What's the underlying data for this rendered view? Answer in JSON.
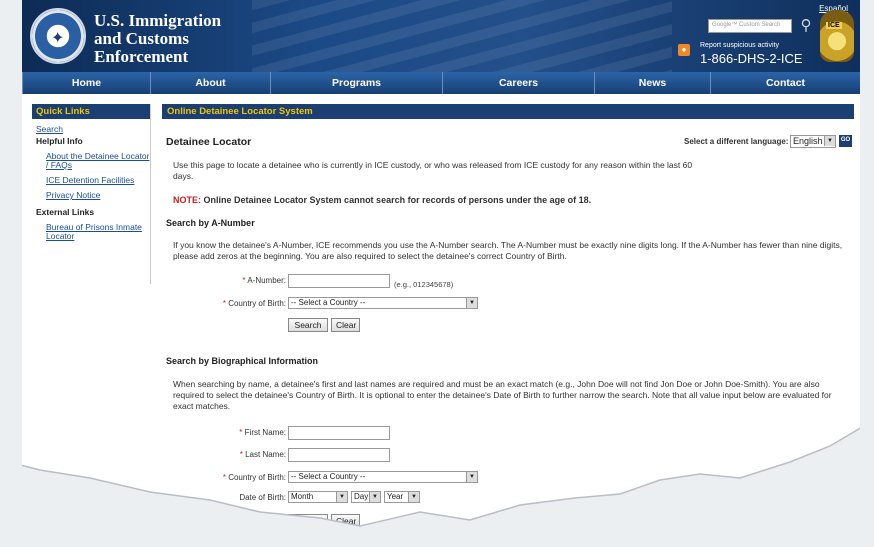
{
  "header": {
    "title_lines": [
      "U.S. Immigration",
      "and Customs",
      "Enforcement"
    ],
    "espanol": "Español",
    "search_placeholder": "Google™ Custom Search",
    "report_label": "Report suspicious activity",
    "report_phone": "1-866-DHS-2-ICE",
    "badge_text": "ICE"
  },
  "nav": [
    {
      "label": "Home"
    },
    {
      "label": "About"
    },
    {
      "label": "Programs"
    },
    {
      "label": "Careers"
    },
    {
      "label": "News"
    },
    {
      "label": "Contact"
    }
  ],
  "sidebar": {
    "title": "Quick Links",
    "search": "Search",
    "helpful_info": "Helpful Info",
    "about_link": "About the Detainee Locator / FAQs",
    "detention_link": "ICE Detention Facilities",
    "privacy_link": "Privacy Notice",
    "external_links": "External Links",
    "bop_link": "Bureau of Prisons Inmate Locator"
  },
  "content": {
    "bar_title": "Online Detainee Locator System",
    "page_title": "Detainee Locator",
    "language_label": "Select a different language:",
    "language_value": "English",
    "go_label": "GO",
    "intro": "Use this page to locate a detainee who is currently in ICE custody, or who was released from ICE custody for any reason within the last 60 days.",
    "note_label": "NOTE:",
    "note_text": "Online Detainee Locator System cannot search for records of persons under the age of 18.",
    "anumber_heading": "Search by A-Number",
    "anumber_text": "If you know the detainee's A-Number, ICE recommends you use the A-Number search. The A-Number must be exactly nine digits long. If the A-Number has fewer than nine digits, please add zeros at the beginning. You are also required to select the detainee's correct Country of Birth.",
    "anumber_label": "A-Number:",
    "anumber_example": "(e.g., 012345678)",
    "country_label": "Country of Birth:",
    "country_value": "-- Select a Country --",
    "search_button": "Search",
    "clear_button": "Clear",
    "bio_heading": "Search by Biographical Information",
    "bio_text": "When searching by name, a detainee's first and last names are required and must be an exact match (e.g., John Doe will not find Jon Doe or John Doe-Smith). You are also required to select the detainee's Country of Birth. It is optional to enter the detainee's Date of Birth to further narrow the search. Note that all value input below are evaluated for exact matches.",
    "first_name_label": "First Name:",
    "last_name_label": "Last Name:",
    "country_label2": "Country of Birth:",
    "country_value2": "-- Select a Country --",
    "dob_label": "Date of Birth:",
    "month_value": "Month",
    "day_value": "Day",
    "year_value": "Year",
    "search_button2": "Search",
    "clear_button2": "Clear",
    "required_mark": "*"
  },
  "colors": {
    "header_navy": "#1b3f73",
    "quick_link_yellow": "#f0c400",
    "note_red": "#c62020",
    "link_blue": "#1a4d9a"
  }
}
